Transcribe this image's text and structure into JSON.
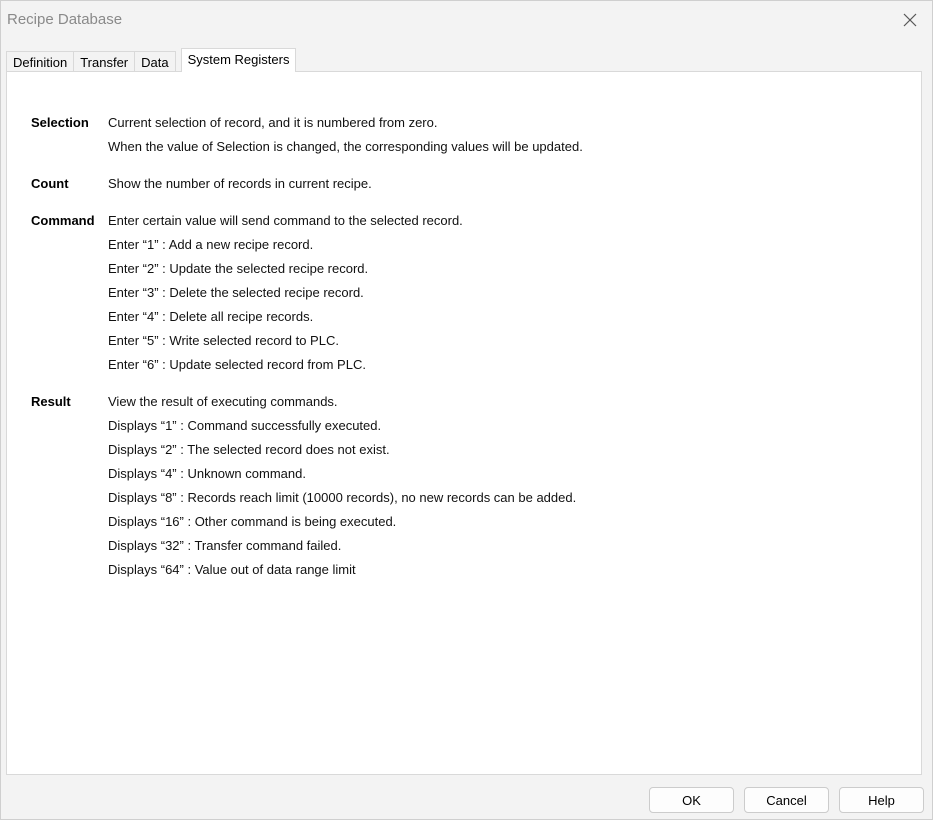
{
  "window": {
    "title": "Recipe Database"
  },
  "tabs": [
    {
      "label": "Definition"
    },
    {
      "label": "Transfer"
    },
    {
      "label": "Data"
    },
    {
      "label": "System Registers"
    }
  ],
  "active_tab": "System Registers",
  "sections": [
    {
      "term": "Selection",
      "lines": [
        "Current selection of record, and it is numbered from zero.",
        "When the value of Selection is changed, the corresponding values will be updated."
      ]
    },
    {
      "term": "Count",
      "lines": [
        "Show the number of records in current recipe."
      ]
    },
    {
      "term": "Command",
      "lines": [
        "Enter certain value will send command to the selected record.",
        "Enter “1” : Add a new recipe record.",
        "Enter “2” : Update the selected recipe record.",
        "Enter “3” : Delete the selected recipe record.",
        "Enter “4” : Delete all recipe records.",
        "Enter “5” : Write selected record to PLC.",
        "Enter “6” : Update selected record from PLC."
      ]
    },
    {
      "term": "Result",
      "lines": [
        "View the result of executing commands.",
        "Displays “1” : Command successfully executed.",
        "Displays “2” : The selected record does not exist.",
        "Displays “4” : Unknown command.",
        "Displays “8” : Records reach limit (10000 records), no new records can be added.",
        "Displays “16” : Other command is being executed.",
        "Displays “32” : Transfer command  failed.",
        "Displays “64” : Value out of data range limit"
      ]
    }
  ],
  "buttons": {
    "ok": "OK",
    "cancel": "Cancel",
    "help": "Help"
  }
}
